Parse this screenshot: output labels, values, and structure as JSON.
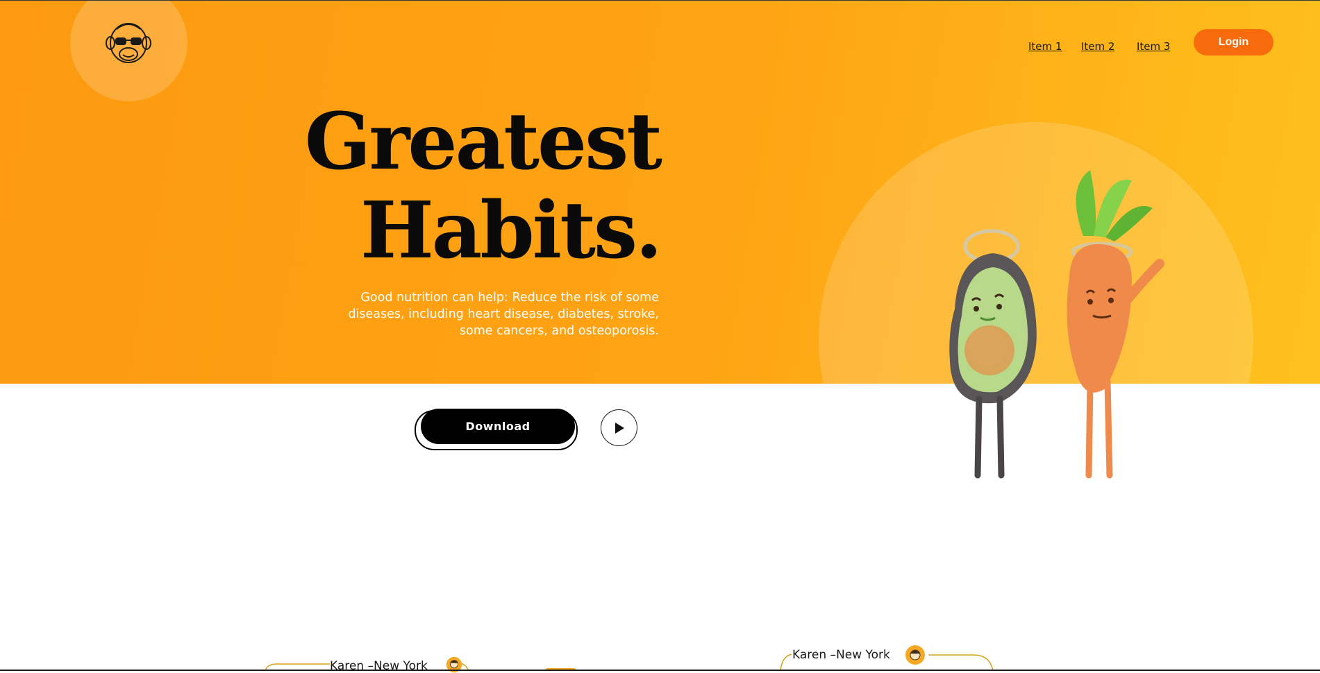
{
  "brand": {
    "logo_icon": "monkey-sunglasses-icon"
  },
  "nav": {
    "items": [
      {
        "label": "Item 1"
      },
      {
        "label": "Item 2"
      },
      {
        "label": "Item 3"
      }
    ],
    "login_label": "Login"
  },
  "hero": {
    "title_line1": "Greatest",
    "title_line2": "Habits.",
    "subtitle": "Good nutrition can help: Reduce the risk of some diseases, including heart disease, diabetes, stroke, some cancers, and osteoporosis.",
    "download_label": "Download",
    "play_icon": "play-icon",
    "illustration": "avocado-carrot-mascots"
  },
  "reviews": [
    {
      "author": "Karen –New York",
      "avatar": "woman-avatar-icon"
    },
    {
      "author": "Karen –New York",
      "avatar": "woman-avatar-icon"
    }
  ],
  "colors": {
    "hero_orange": "#fd9a10",
    "hero_yellow": "#fec11d",
    "login_orange": "#f76b0d",
    "title_black": "#0a0a0a",
    "outline_gold": "#d9a21a"
  }
}
